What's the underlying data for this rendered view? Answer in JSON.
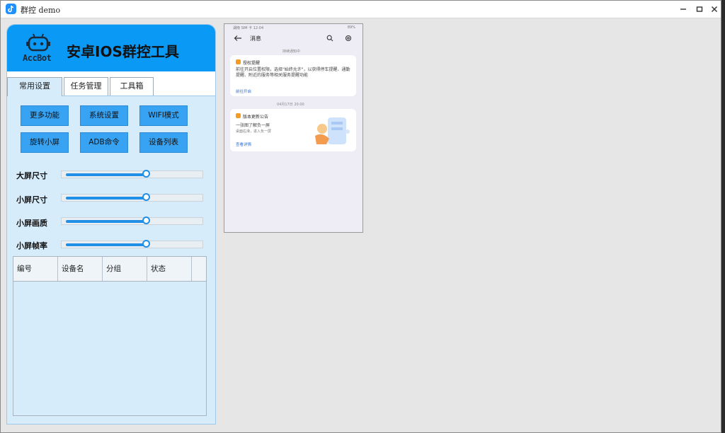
{
  "window": {
    "title": "群控 demo"
  },
  "app": {
    "logo_text": "AccBot",
    "title": "安卓IOS群控工具"
  },
  "tabs": [
    "常用设置",
    "任务管理",
    "工具箱"
  ],
  "buttons": [
    "更多功能",
    "系统设置",
    "WIFI模式",
    "旋转小屏",
    "ADB命令",
    "设备列表"
  ],
  "sliders": [
    {
      "label": "大屏尺寸",
      "level": 0.6
    },
    {
      "label": "小屏尺寸",
      "level": 0.6
    },
    {
      "label": "小屏画质",
      "level": 0.6
    },
    {
      "label": "小屏帧率",
      "level": 0.6
    }
  ],
  "table": {
    "columns": [
      "编号",
      "设备名",
      "分组",
      "状态"
    ],
    "rows": []
  },
  "phone": {
    "status_left": "湖南 SIM 卡 12:04",
    "status_right": "89%",
    "title": "消息",
    "section1": "持续通知中",
    "card1": {
      "title": "授权提醒",
      "body": "前往开启位置权限，选择\"始终允许\"，以获得停车提醒、通勤提醒、附近的服务等相关服务提醒功能",
      "link": "前往开启"
    },
    "date": "04月17日 20:00",
    "card2": {
      "title": "版本更新公告",
      "headline": "一张图了解负一屏",
      "sub": "桌面右滑，进入负一屏",
      "link": "查看详情"
    }
  },
  "colors": {
    "accent": "#0a99f5",
    "button": "#38a3f2",
    "panel": "#d7ecfb"
  }
}
